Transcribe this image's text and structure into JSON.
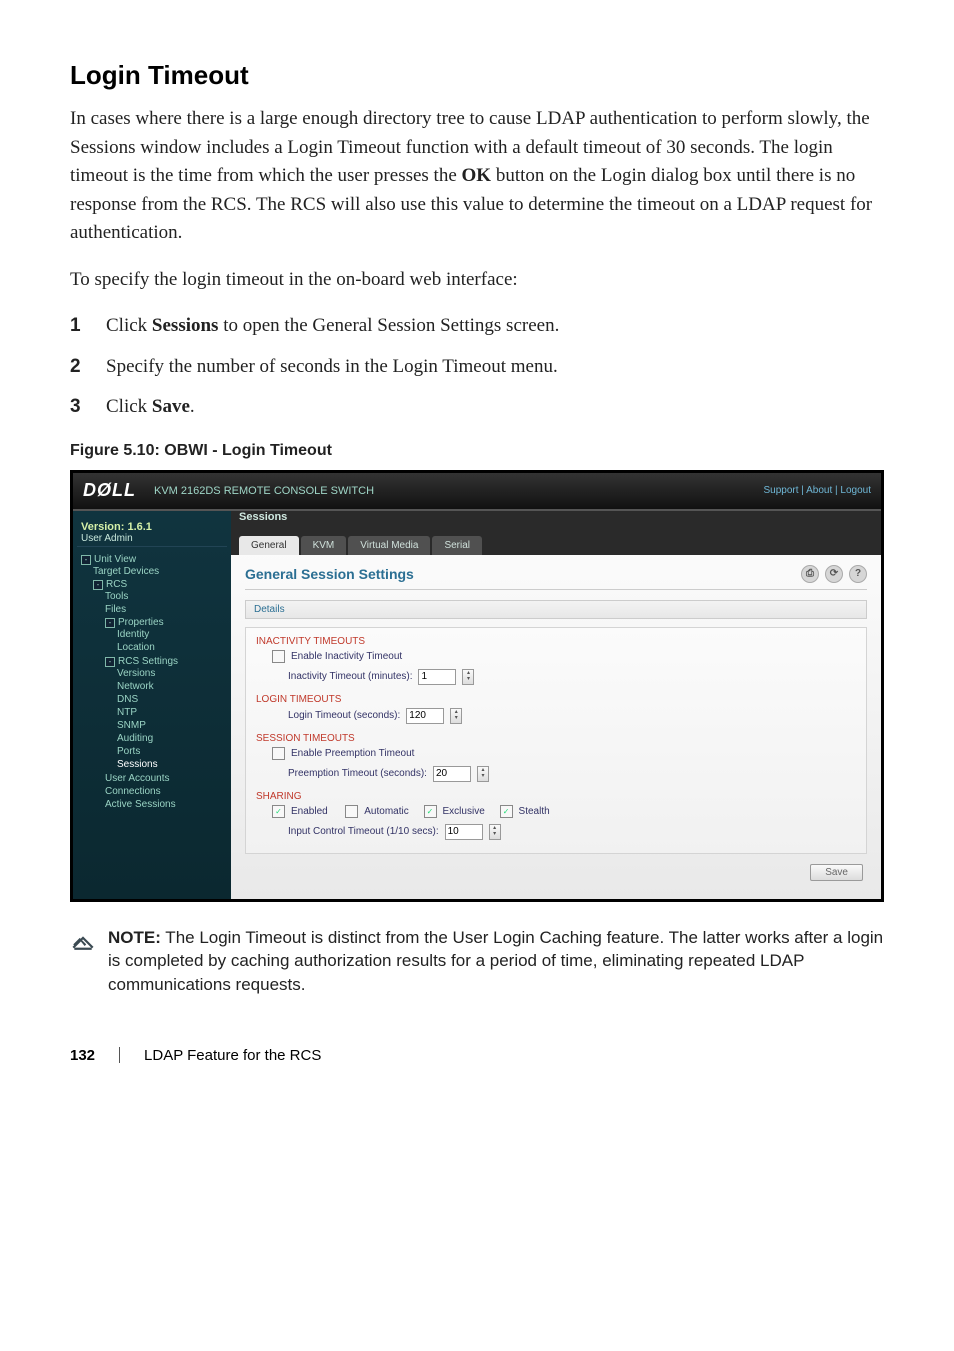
{
  "section": {
    "title": "Login Timeout",
    "paragraph1": "In cases where there is a large enough directory tree to cause LDAP authentication to perform slowly, the Sessions window includes a Login Timeout function with a default timeout of 30 seconds. The login timeout is the time from which the user presses the ",
    "paragraph1_bold": "OK",
    "paragraph1_tail": " button on the Login dialog box until there is no response from the RCS. The RCS will also use this value to determine the timeout on a LDAP request for authentication.",
    "paragraph2": "To specify the login timeout in the on-board web interface:",
    "steps": [
      {
        "num": "1",
        "pre": "Click ",
        "bold": "Sessions",
        "post": " to open the General Session Settings screen."
      },
      {
        "num": "2",
        "pre": "Specify the number of seconds in the Login Timeout menu.",
        "bold": "",
        "post": ""
      },
      {
        "num": "3",
        "pre": "Click ",
        "bold": "Save",
        "post": "."
      }
    ]
  },
  "figure_caption": "Figure 5.10: OBWI - Login Timeout",
  "app": {
    "brand": "DØLL",
    "title": "KVM 2162DS REMOTE CONSOLE SWITCH",
    "top_links": "Support  |  About  |  Logout",
    "sidebar": {
      "version_line": "Version: 1.6.1",
      "user_line": "User Admin",
      "tree": {
        "unit_view": "Unit View",
        "target_devices": "Target Devices",
        "rcs": "RCS",
        "tools": "Tools",
        "files": "Files",
        "properties": "Properties",
        "identity": "Identity",
        "location": "Location",
        "rcs_settings": "RCS Settings",
        "versions": "Versions",
        "network": "Network",
        "dns": "DNS",
        "ntp": "NTP",
        "snmp": "SNMP",
        "auditing": "Auditing",
        "ports": "Ports",
        "sessions": "Sessions",
        "user_accounts": "User Accounts",
        "connections": "Connections",
        "active_sessions": "Active Sessions"
      }
    },
    "main": {
      "header_title": "Sessions",
      "tabs": {
        "general": "General",
        "kvm": "KVM",
        "virtual_media": "Virtual Media",
        "serial": "Serial"
      },
      "heading": "General Session Settings",
      "details_label": "Details",
      "groups": {
        "inactivity_title": "INACTIVITY TIMEOUTS",
        "enable_inactivity": "Enable Inactivity Timeout",
        "inactivity_label": "Inactivity Timeout (minutes):",
        "inactivity_value": "1",
        "login_title": "LOGIN TIMEOUTS",
        "login_label": "Login Timeout (seconds):",
        "login_value": "120",
        "session_title": "SESSION TIMEOUTS",
        "enable_preemption": "Enable Preemption Timeout",
        "preemption_label": "Preemption Timeout (seconds):",
        "preemption_value": "20",
        "sharing_title": "SHARING",
        "sharing_enabled": "Enabled",
        "sharing_automatic": "Automatic",
        "sharing_exclusive": "Exclusive",
        "sharing_stealth": "Stealth",
        "input_control_label": "Input Control Timeout (1/10 secs):",
        "input_control_value": "10"
      },
      "save_label": "Save"
    }
  },
  "note": {
    "label": "NOTE:",
    "text": " The Login Timeout is distinct from the User Login Caching feature. The latter works after a login is completed by caching authorization results for a period of time, eliminating repeated LDAP communications requests."
  },
  "footer": {
    "page": "132",
    "section": "LDAP Feature for the RCS"
  }
}
